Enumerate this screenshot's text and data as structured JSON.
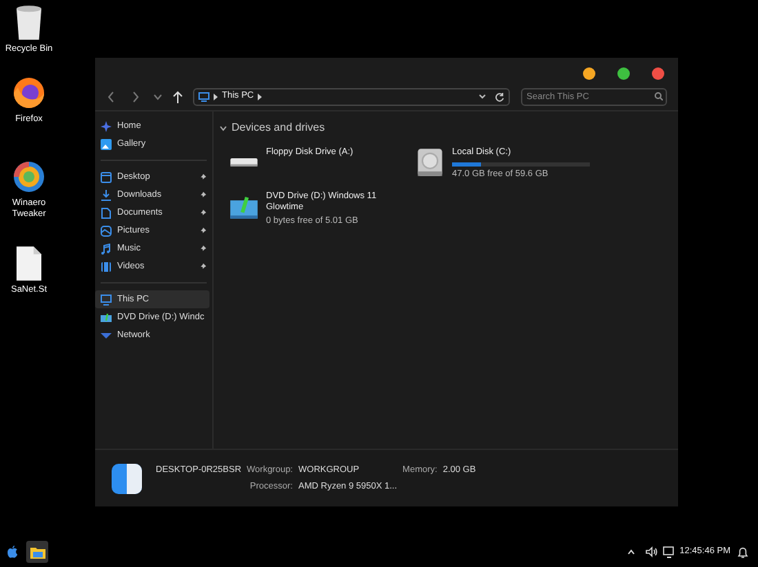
{
  "desktop_icons": [
    {
      "label": "Recycle Bin",
      "kind": "bin"
    },
    {
      "label": "Firefox",
      "kind": "firefox"
    },
    {
      "label": "Winaero Tweaker",
      "kind": "tweaker"
    },
    {
      "label": "SaNet.St",
      "kind": "file"
    }
  ],
  "window": {
    "address": "This PC",
    "search_placeholder": "Search This PC"
  },
  "nav_sections": [
    [
      {
        "label": "Home",
        "kind": "home",
        "pinned": false,
        "selected": false
      },
      {
        "label": "Gallery",
        "kind": "gallery",
        "pinned": false,
        "selected": false
      }
    ],
    [
      {
        "label": "Desktop",
        "kind": "desktop",
        "pinned": true,
        "selected": false
      },
      {
        "label": "Downloads",
        "kind": "downloads",
        "pinned": true,
        "selected": false
      },
      {
        "label": "Documents",
        "kind": "documents",
        "pinned": true,
        "selected": false
      },
      {
        "label": "Pictures",
        "kind": "pictures",
        "pinned": true,
        "selected": false
      },
      {
        "label": "Music",
        "kind": "music",
        "pinned": true,
        "selected": false
      },
      {
        "label": "Videos",
        "kind": "videos",
        "pinned": true,
        "selected": false
      }
    ],
    [
      {
        "label": "This PC",
        "kind": "pc",
        "pinned": false,
        "selected": true
      },
      {
        "label": "DVD Drive (D:) Windc",
        "kind": "dvd",
        "pinned": false,
        "selected": false
      },
      {
        "label": "Network",
        "kind": "network",
        "pinned": false,
        "selected": false
      }
    ]
  ],
  "group": {
    "title": "Devices and drives",
    "expanded": true
  },
  "drives": [
    {
      "name": "Floppy Disk Drive (A:)",
      "kind": "floppy"
    },
    {
      "name": "Local Disk (C:)",
      "kind": "disk",
      "level": 0.21,
      "free": "47.0 GB free of 59.6 GB"
    },
    {
      "name": "DVD Drive (D:) Windows 11 Glowtime",
      "kind": "dvd",
      "free": "0 bytes free of 5.01 GB"
    }
  ],
  "details": {
    "computer": "DESKTOP-0R25BSR",
    "fields": [
      {
        "label": "Workgroup:",
        "value": "WORKGROUP"
      },
      {
        "label": "Memory:",
        "value": "2.00 GB"
      },
      {
        "label": "Processor:",
        "value": "AMD Ryzen 9 5950X 1..."
      }
    ]
  },
  "taskbar": {
    "time": "12:45:46 PM"
  }
}
